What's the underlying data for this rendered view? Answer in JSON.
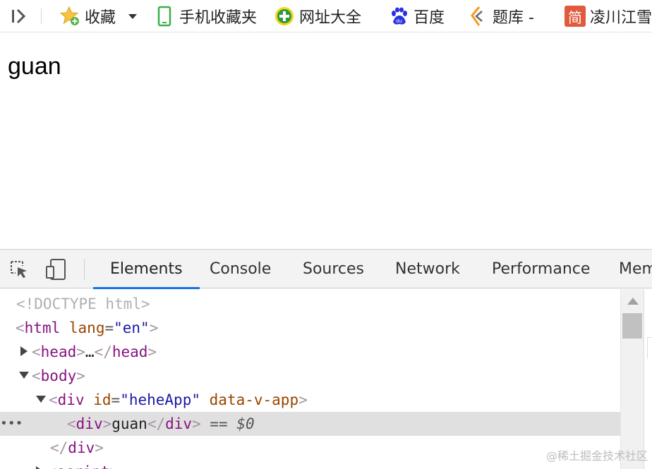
{
  "bookmarks_bar": {
    "items": [
      {
        "label": "收藏",
        "icon": "star-plus-icon"
      },
      {
        "label": "手机收藏夹",
        "icon": "phone-icon"
      },
      {
        "label": "网址大全",
        "icon": "green-plus-icon"
      },
      {
        "label": "百度",
        "icon": "baidu-paw-icon"
      },
      {
        "label": "题库 -",
        "icon": "tiku-icon"
      },
      {
        "label": "凌川江雪",
        "icon": "jian-icon"
      }
    ],
    "jian_icon_text": "简"
  },
  "page": {
    "body_text": "guan"
  },
  "devtools": {
    "tabs": [
      "Elements",
      "Console",
      "Sources",
      "Network",
      "Performance",
      "Mem"
    ],
    "active_tab": "Elements",
    "accent_color": "#1a73e8",
    "dom": {
      "doctype": "<!DOCTYPE html>",
      "html_tag": "html",
      "html_attr_name": "lang",
      "html_attr_value": "\"en\"",
      "head_tag": "head",
      "ellipsis": "…",
      "body_tag": "body",
      "div_tag": "div",
      "div_id_name": "id",
      "div_id_value": "\"heheApp\"",
      "div_data_attr": "data-v-app",
      "inner_text": "guan",
      "selected_suffix_eq": "==",
      "selected_suffix_var": "$0",
      "script_tag": "script"
    }
  },
  "watermark": "@稀土掘金技术社区"
}
